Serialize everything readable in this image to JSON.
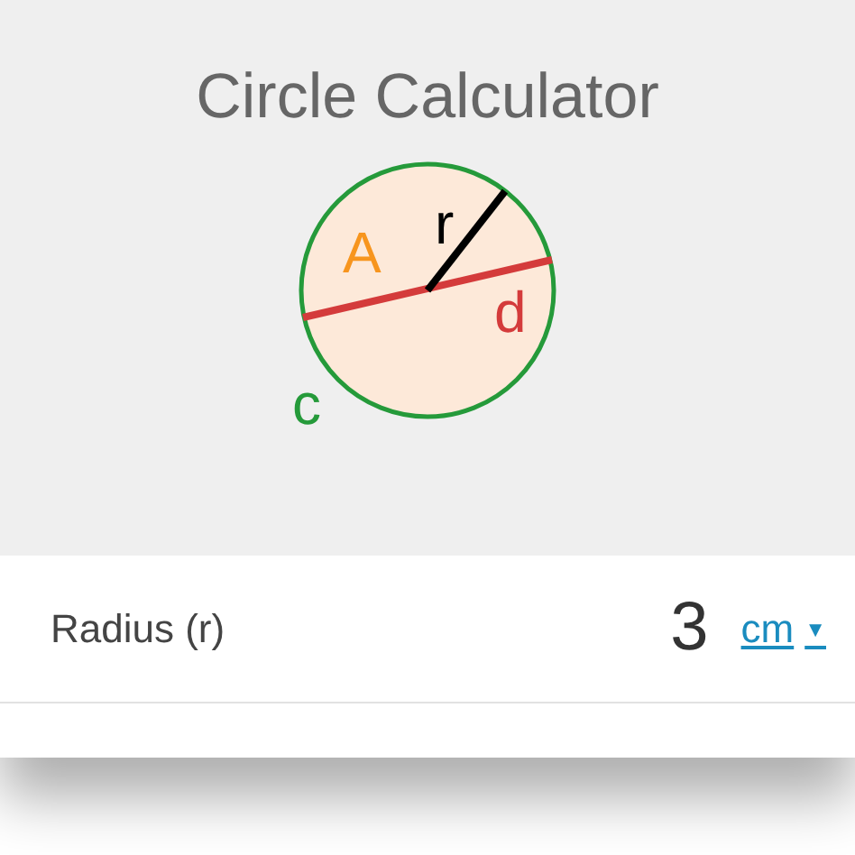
{
  "title": "Circle Calculator",
  "diagram": {
    "labels": [
      {
        "kind": "area",
        "text": "A"
      },
      {
        "kind": "radius",
        "text": "r"
      },
      {
        "kind": "diameter",
        "text": "d"
      },
      {
        "kind": "circumference",
        "text": "c"
      }
    ]
  },
  "fields": [
    {
      "label": "Radius (r)",
      "value": "3",
      "unit": "cm",
      "caret": "▼"
    }
  ]
}
